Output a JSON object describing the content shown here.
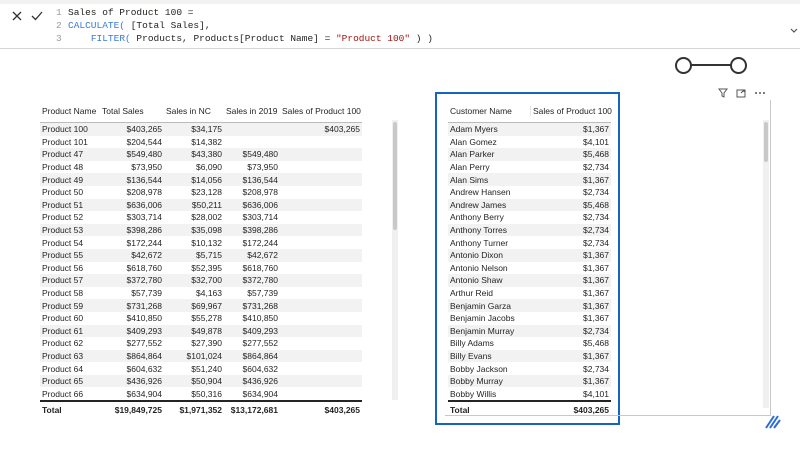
{
  "formula": {
    "line1": "Sales of Product 100 =",
    "line2_fn": "CALCULATE(",
    "line2_arg": " [Total Sales],",
    "line3_fn": "FILTER(",
    "line3_a": " Products, Products[Product Name] = ",
    "line3_str": "\"Product 100\"",
    "line3_b": " ) )",
    "ln1": "1",
    "ln2": "2",
    "ln3": "3"
  },
  "left_table": {
    "headers": [
      "Product Name",
      "Total Sales",
      "Sales in NC",
      "Sales in 2019",
      "Sales of Product 100"
    ],
    "rows": [
      [
        "Product 100",
        "$403,265",
        "$34,175",
        "",
        "$403,265"
      ],
      [
        "Product 101",
        "$204,544",
        "$14,382",
        "",
        ""
      ],
      [
        "Product 47",
        "$549,480",
        "$43,380",
        "$549,480",
        ""
      ],
      [
        "Product 48",
        "$73,950",
        "$6,090",
        "$73,950",
        ""
      ],
      [
        "Product 49",
        "$136,544",
        "$14,056",
        "$136,544",
        ""
      ],
      [
        "Product 50",
        "$208,978",
        "$23,128",
        "$208,978",
        ""
      ],
      [
        "Product 51",
        "$636,006",
        "$50,211",
        "$636,006",
        ""
      ],
      [
        "Product 52",
        "$303,714",
        "$28,002",
        "$303,714",
        ""
      ],
      [
        "Product 53",
        "$398,286",
        "$35,098",
        "$398,286",
        ""
      ],
      [
        "Product 54",
        "$172,244",
        "$10,132",
        "$172,244",
        ""
      ],
      [
        "Product 55",
        "$42,672",
        "$5,715",
        "$42,672",
        ""
      ],
      [
        "Product 56",
        "$618,760",
        "$52,395",
        "$618,760",
        ""
      ],
      [
        "Product 57",
        "$372,780",
        "$32,700",
        "$372,780",
        ""
      ],
      [
        "Product 58",
        "$57,739",
        "$4,163",
        "$57,739",
        ""
      ],
      [
        "Product 59",
        "$731,268",
        "$69,967",
        "$731,268",
        ""
      ],
      [
        "Product 60",
        "$410,850",
        "$55,278",
        "$410,850",
        ""
      ],
      [
        "Product 61",
        "$409,293",
        "$49,878",
        "$409,293",
        ""
      ],
      [
        "Product 62",
        "$277,552",
        "$27,390",
        "$277,552",
        ""
      ],
      [
        "Product 63",
        "$864,864",
        "$101,024",
        "$864,864",
        ""
      ],
      [
        "Product 64",
        "$604,632",
        "$51,240",
        "$604,632",
        ""
      ],
      [
        "Product 65",
        "$436,926",
        "$50,904",
        "$436,926",
        ""
      ],
      [
        "Product 66",
        "$634,904",
        "$50,316",
        "$634,904",
        ""
      ]
    ],
    "total": [
      "Total",
      "$19,849,725",
      "$1,971,352",
      "$13,172,681",
      "$403,265"
    ]
  },
  "right_table": {
    "headers": [
      "Customer Name",
      "Sales of Product 100"
    ],
    "rows": [
      [
        "Adam Myers",
        "$1,367"
      ],
      [
        "Alan Gomez",
        "$4,101"
      ],
      [
        "Alan Parker",
        "$5,468"
      ],
      [
        "Alan Perry",
        "$2,734"
      ],
      [
        "Alan Sims",
        "$1,367"
      ],
      [
        "Andrew Hansen",
        "$2,734"
      ],
      [
        "Andrew James",
        "$5,468"
      ],
      [
        "Anthony Berry",
        "$2,734"
      ],
      [
        "Anthony Torres",
        "$2,734"
      ],
      [
        "Anthony Turner",
        "$2,734"
      ],
      [
        "Antonio Dixon",
        "$1,367"
      ],
      [
        "Antonio Nelson",
        "$1,367"
      ],
      [
        "Antonio Shaw",
        "$1,367"
      ],
      [
        "Arthur Reid",
        "$1,367"
      ],
      [
        "Benjamin Garza",
        "$1,367"
      ],
      [
        "Benjamin Jacobs",
        "$1,367"
      ],
      [
        "Benjamin Murray",
        "$2,734"
      ],
      [
        "Billy Adams",
        "$5,468"
      ],
      [
        "Billy Evans",
        "$1,367"
      ],
      [
        "Bobby Jackson",
        "$2,734"
      ],
      [
        "Bobby Murray",
        "$1,367"
      ],
      [
        "Bobby Willis",
        "$4,101"
      ]
    ],
    "total": [
      "Total",
      "$403,265"
    ]
  },
  "icons": {
    "cancel": "close-icon",
    "commit": "checkmark-icon",
    "filter": "filter-icon",
    "focus": "focus-mode-icon",
    "more": "more-options-icon"
  },
  "colors": {
    "selection": "#1565c0"
  }
}
